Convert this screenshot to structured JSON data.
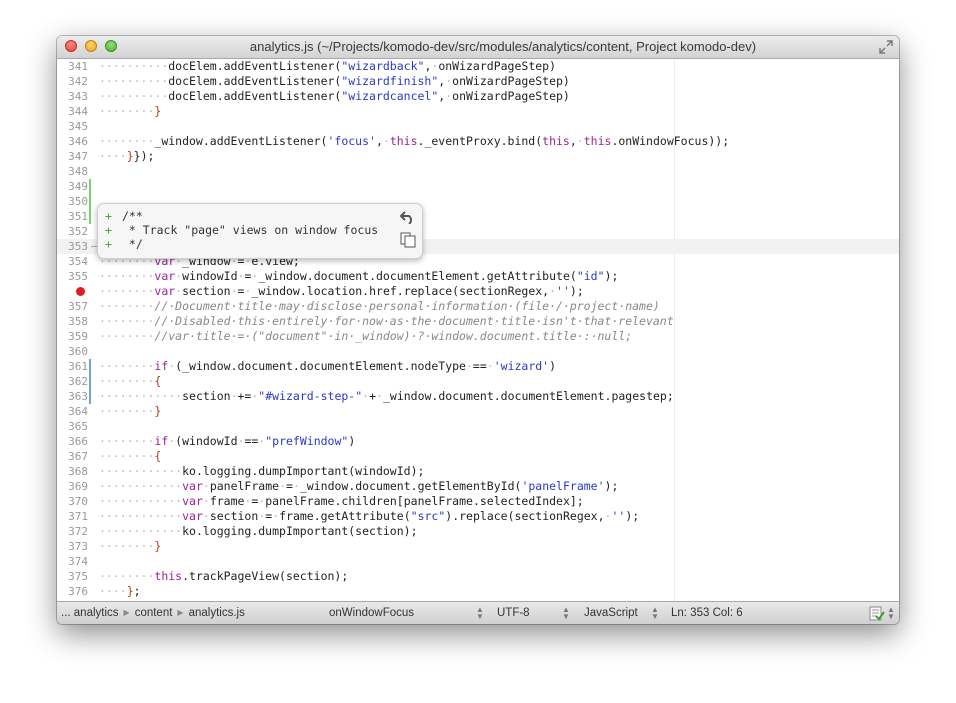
{
  "window": {
    "title": "analytics.js (~/Projects/komodo-dev/src/modules/analytics/content, Project komodo-dev)"
  },
  "editor": {
    "lines": [
      {
        "n": "341",
        "html": "<span class=\"d\">········</span><span class=\"d\">··</span>docElem.addEventListener(<span class=\"s\">\"wizardback\"</span>,<span class=\"d\">·</span>onWizardPageStep)"
      },
      {
        "n": "342",
        "html": "<span class=\"d\">··········</span>docElem.addEventListener(<span class=\"s\">\"wizardfinish\"</span>,<span class=\"d\">·</span>onWizardPageStep)"
      },
      {
        "n": "343",
        "html": "<span class=\"d\">··········</span>docElem.addEventListener(<span class=\"s\">\"wizardcancel\"</span>,<span class=\"d\">·</span>onWizardPageStep)"
      },
      {
        "n": "344",
        "html": "<span class=\"d\">········</span><span class=\"p\">}</span>"
      },
      {
        "n": "345",
        "html": ""
      },
      {
        "n": "346",
        "html": "<span class=\"d\">········</span>_window.addEventListener(<span class=\"s\">'focus'</span>,<span class=\"d\">·</span><span class=\"k\">this</span>._eventProxy.bind(<span class=\"k\">this</span>,<span class=\"d\">·</span><span class=\"k\">this</span>.onWindowFocus));"
      },
      {
        "n": "347",
        "html": "<span class=\"d\">····</span><span class=\"p\">}</span>});"
      },
      {
        "n": "348",
        "html": ""
      },
      {
        "n": "349",
        "html": ""
      },
      {
        "n": "350",
        "html": ""
      },
      {
        "n": "351",
        "html": ""
      },
      {
        "n": "352",
        "html": ""
      },
      {
        "n": "353",
        "html": "<span class=\"d\">····</span><span class=\"p\">{</span>"
      },
      {
        "n": "354",
        "html": "<span class=\"d\">········</span><span class=\"k\">var</span><span class=\"d\">·</span>_window<span class=\"d\">·</span>=<span class=\"d\">·</span>e.view;"
      },
      {
        "n": "355",
        "html": "<span class=\"d\">········</span><span class=\"k\">var</span><span class=\"d\">·</span>windowId<span class=\"d\">·</span>=<span class=\"d\">·</span>_window.document.documentElement.getAttribute(<span class=\"s\">\"id\"</span>);"
      },
      {
        "n": "",
        "bp": true,
        "html": "<span class=\"d\">········</span><span class=\"k\">var</span><span class=\"d\">·</span>section<span class=\"d\">·</span>=<span class=\"d\">·</span>_window.location.href.replace(sectionRegex,<span class=\"d\">·</span><span class=\"s\">''</span>);"
      },
      {
        "n": "357",
        "html": "<span class=\"d\">········</span><span class=\"c\">//·Document·title·may·disclose·personal·information·(file·/·project·name)</span>"
      },
      {
        "n": "358",
        "html": "<span class=\"d\">········</span><span class=\"c\">//·Disabled·this·entirely·for·now·as·the·document·title·isn't·that·relevant</span>"
      },
      {
        "n": "359",
        "html": "<span class=\"d\">········</span><span class=\"c\">//var·title·=·(\"document\"·in·_window)·?·window.document.title·:·null;</span>"
      },
      {
        "n": "360",
        "html": ""
      },
      {
        "n": "361",
        "html": "<span class=\"d\">········</span><span class=\"k\">if</span><span class=\"d\">·</span>(_window.document.documentElement.nodeType<span class=\"d\">·</span>==<span class=\"d\">·</span><span class=\"s\">'wizard'</span>)"
      },
      {
        "n": "362",
        "html": "<span class=\"d\">········</span><span class=\"p\">{</span>"
      },
      {
        "n": "363",
        "html": "<span class=\"d\">············</span>section<span class=\"d\">·</span>+=<span class=\"d\">·</span><span class=\"s\">\"#wizard-step-\"</span><span class=\"d\">·</span>+<span class=\"d\">·</span>_window.document.documentElement.pagestep;"
      },
      {
        "n": "364",
        "html": "<span class=\"d\">········</span><span class=\"p\">}</span>"
      },
      {
        "n": "365",
        "html": ""
      },
      {
        "n": "366",
        "html": "<span class=\"d\">········</span><span class=\"k\">if</span><span class=\"d\">·</span>(windowId<span class=\"d\">·</span>==<span class=\"d\">·</span><span class=\"s\">\"prefWindow\"</span>)"
      },
      {
        "n": "367",
        "html": "<span class=\"d\">········</span><span class=\"p\">{</span>"
      },
      {
        "n": "368",
        "html": "<span class=\"d\">············</span>ko.logging.dumpImportant(windowId);"
      },
      {
        "n": "369",
        "html": "<span class=\"d\">············</span><span class=\"k\">var</span><span class=\"d\">·</span>panelFrame<span class=\"d\">·</span>=<span class=\"d\">·</span>_window.document.getElementById(<span class=\"s\">'panelFrame'</span>);"
      },
      {
        "n": "370",
        "html": "<span class=\"d\">············</span><span class=\"k\">var</span><span class=\"d\">·</span>frame<span class=\"d\">·</span>=<span class=\"d\">·</span>panelFrame.children[panelFrame.selectedIndex];"
      },
      {
        "n": "371",
        "html": "<span class=\"d\">············</span><span class=\"k\">var</span><span class=\"d\">·</span>section<span class=\"d\">·</span>=<span class=\"d\">·</span>frame.getAttribute(<span class=\"s\">\"src\"</span>).replace(sectionRegex,<span class=\"d\">·</span><span class=\"s\">''</span>);"
      },
      {
        "n": "372",
        "html": "<span class=\"d\">············</span>ko.logging.dumpImportant(section);"
      },
      {
        "n": "373",
        "html": "<span class=\"d\">········</span><span class=\"p\">}</span>"
      },
      {
        "n": "374",
        "html": ""
      },
      {
        "n": "375",
        "html": "<span class=\"d\">········</span><span class=\"k\">this</span>.trackPageView(section);"
      },
      {
        "n": "376",
        "html": "<span class=\"d\">····</span><span class=\"p\">}</span>;"
      }
    ],
    "hidden_line_numbers": [
      "348",
      "349",
      "350",
      "351",
      "352"
    ]
  },
  "popup": {
    "lines": [
      {
        "sign": "+",
        "text": "/**"
      },
      {
        "sign": "+",
        "text": " * Track \"page\" views on window focus"
      },
      {
        "sign": "+",
        "text": " */"
      }
    ]
  },
  "statusbar": {
    "crumbs": [
      "... analytics",
      "content",
      "analytics.js"
    ],
    "function": "onWindowFocus",
    "encoding": "UTF-8",
    "language": "JavaScript",
    "position": "Ln: 353 Col: 6"
  }
}
